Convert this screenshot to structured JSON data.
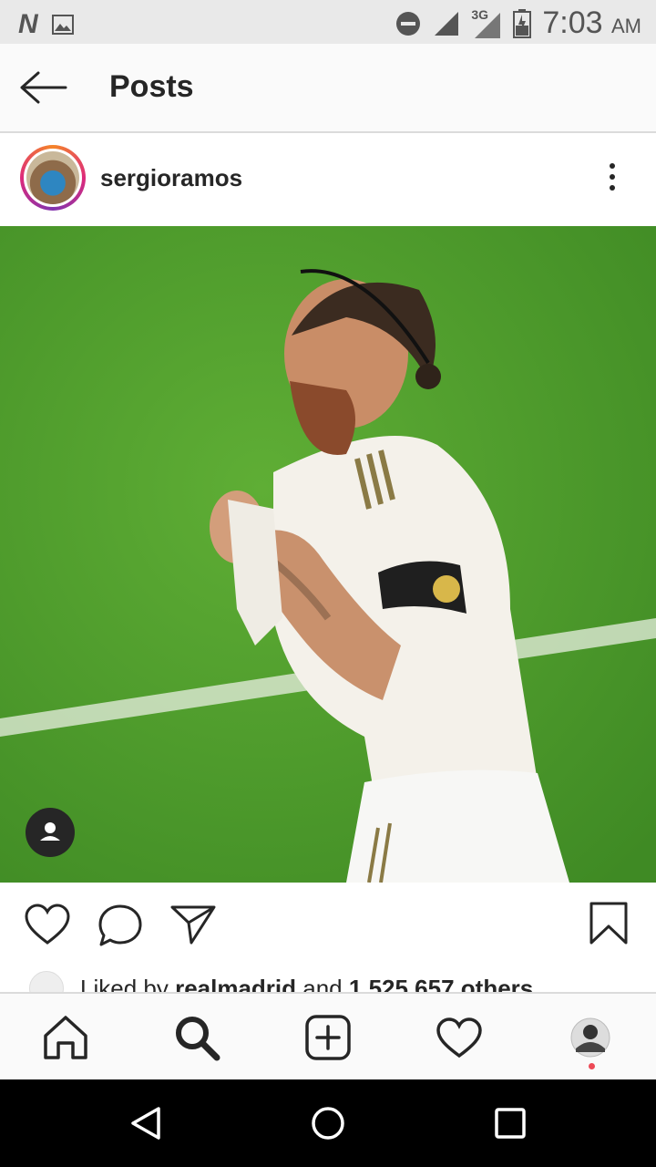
{
  "status_bar": {
    "time": "7:03",
    "ampm": "AM",
    "network": "3G",
    "icons": [
      "n-app-icon",
      "gallery-icon",
      "do-not-disturb-icon",
      "signal-icon",
      "battery-icon"
    ]
  },
  "header": {
    "title": "Posts"
  },
  "post": {
    "username": "sergioramos",
    "likes": {
      "prefix": "Liked by",
      "user": "realmadrid",
      "middle": "and",
      "count": "1,525,657 others"
    },
    "photo_subject": "football player in white kit pulling his jersey on a green pitch"
  },
  "colors": {
    "accent_ring": [
      "#f58529",
      "#dd2a7b",
      "#8134af"
    ],
    "notification_dot": "#ed4956",
    "pitch": "#4a9a2a"
  },
  "bottom_nav": [
    "home-icon",
    "search-icon",
    "new-post-icon",
    "activity-icon",
    "profile-avatar"
  ],
  "system_nav": [
    "back-icon",
    "home-icon",
    "recents-icon"
  ]
}
